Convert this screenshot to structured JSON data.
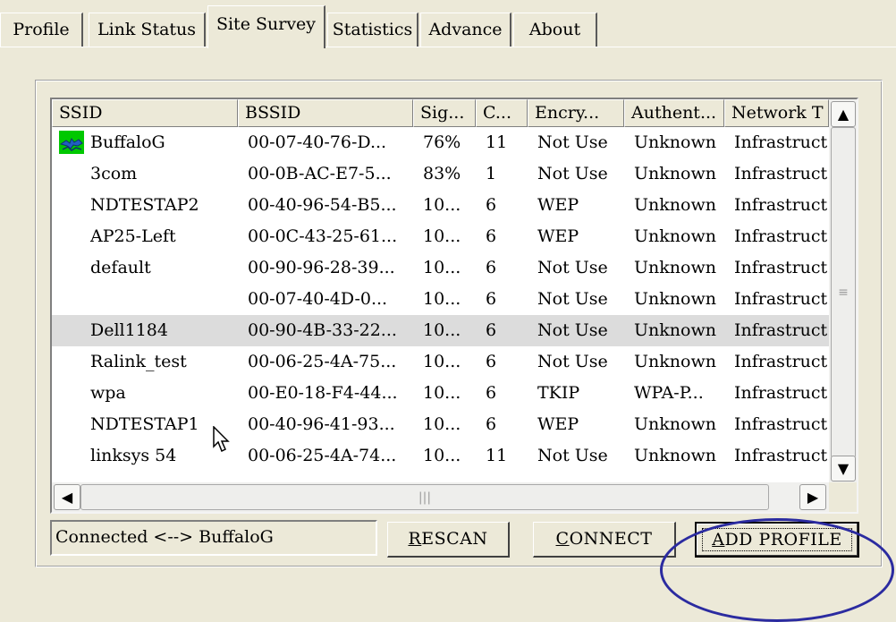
{
  "tabs": [
    {
      "label": "Profile"
    },
    {
      "label": "Link Status"
    },
    {
      "label": "Site Survey"
    },
    {
      "label": "Statistics"
    },
    {
      "label": "Advance"
    },
    {
      "label": "About"
    }
  ],
  "table": {
    "columns": [
      "SSID",
      "BSSID",
      "Sig...",
      "C...",
      "Encry...",
      "Authent...",
      "Network T"
    ],
    "rows": [
      {
        "ssid": "BuffaloG",
        "bssid": "00-07-40-76-D...",
        "signal": "76%",
        "channel": "11",
        "encryption": "Not Use",
        "auth": "Unknown",
        "network": "Infrastruct."
      },
      {
        "ssid": "3com",
        "bssid": "00-0B-AC-E7-5...",
        "signal": "83%",
        "channel": "1",
        "encryption": "Not Use",
        "auth": "Unknown",
        "network": "Infrastruct."
      },
      {
        "ssid": "NDTESTAP2",
        "bssid": "00-40-96-54-B5...",
        "signal": "10...",
        "channel": "6",
        "encryption": "WEP",
        "auth": "Unknown",
        "network": "Infrastruct."
      },
      {
        "ssid": "AP25-Left",
        "bssid": "00-0C-43-25-61...",
        "signal": "10...",
        "channel": "6",
        "encryption": "WEP",
        "auth": "Unknown",
        "network": "Infrastruct."
      },
      {
        "ssid": "default",
        "bssid": "00-90-96-28-39...",
        "signal": "10...",
        "channel": "6",
        "encryption": "Not Use",
        "auth": "Unknown",
        "network": "Infrastruct."
      },
      {
        "ssid": "",
        "bssid": "00-07-40-4D-0...",
        "signal": "10...",
        "channel": "6",
        "encryption": "Not Use",
        "auth": "Unknown",
        "network": "Infrastruct."
      },
      {
        "ssid": "Dell1184",
        "bssid": "00-90-4B-33-22...",
        "signal": "10...",
        "channel": "6",
        "encryption": "Not Use",
        "auth": "Unknown",
        "network": "Infrastruct."
      },
      {
        "ssid": "Ralink_test",
        "bssid": "00-06-25-4A-75...",
        "signal": "10...",
        "channel": "6",
        "encryption": "Not Use",
        "auth": "Unknown",
        "network": "Infrastruct."
      },
      {
        "ssid": "wpa",
        "bssid": "00-E0-18-F4-44...",
        "signal": "10...",
        "channel": "6",
        "encryption": "TKIP",
        "auth": "WPA-P...",
        "network": "Infrastruct."
      },
      {
        "ssid": "NDTESTAP1",
        "bssid": "00-40-96-41-93...",
        "signal": "10...",
        "channel": "6",
        "encryption": "WEP",
        "auth": "Unknown",
        "network": "Infrastruct."
      },
      {
        "ssid": "linksys 54",
        "bssid": "00-06-25-4A-74...",
        "signal": "10...",
        "channel": "11",
        "encryption": "Not Use",
        "auth": "Unknown",
        "network": "Infrastruct."
      }
    ]
  },
  "status_text": "Connected <--> BuffaloG",
  "buttons": {
    "rescan": {
      "mnemonic": "R",
      "rest": "ESCAN"
    },
    "connect": {
      "mnemonic": "C",
      "rest": "ONNECT"
    },
    "add_profile": {
      "mnemonic": "A",
      "rest": "DD PROFILE"
    }
  },
  "scroll": {
    "up": "▲",
    "down": "▼",
    "left": "◀",
    "right": "▶",
    "vgrip": "≡",
    "hgrip": "|||"
  },
  "colors": {
    "background": "#ece9d8",
    "connected_icon": "#00c800",
    "highlight_ellipse": "#2b2ba0"
  }
}
